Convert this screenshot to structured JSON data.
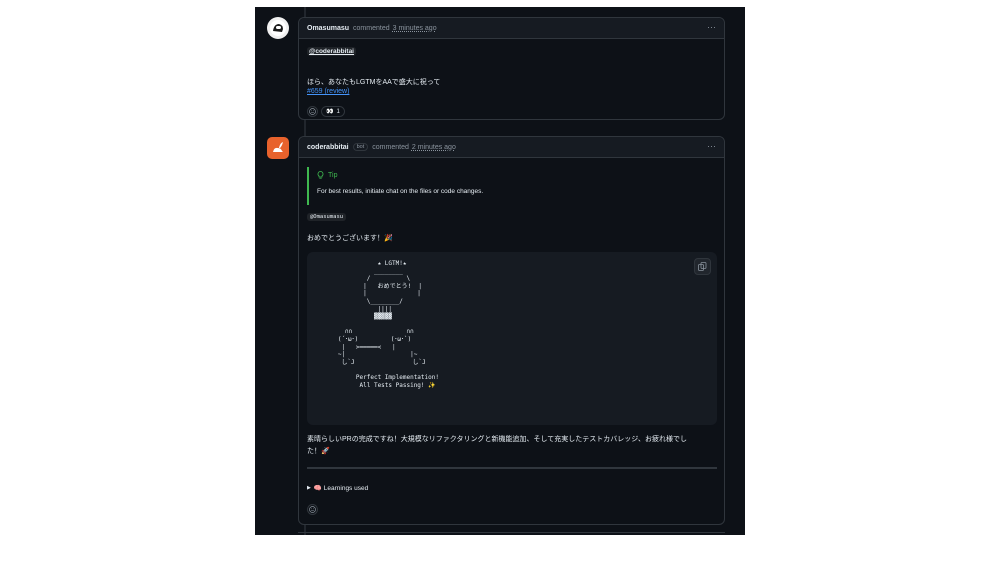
{
  "comment1": {
    "author": "Omasumasu",
    "action": "commented",
    "time": "3 minutes ago",
    "more": "···",
    "mention": "@coderabbitai",
    "text": "ほら、あなたもLGTMをAAで盛大に祝って",
    "link": "#659 (review)",
    "reaction_emoji": "👀",
    "reaction_count": "1"
  },
  "comment2": {
    "author": "coderabbitai",
    "badge": "bot",
    "action": "commented",
    "time": "2 minutes ago",
    "more": "···",
    "tip_title": "Tip",
    "tip_text": "For best results, initiate chat on the files or code changes.",
    "mention": "@Omasumasu",
    "congrats": "おめでとうございます！🎉",
    "ascii_art": "              ★ LGTM!★\n             ________\n           /          \\\n          |   おめでとう!  |\n          |              |\n           \\________/\n              ||||\n             ▓▓▓▓▓\n\n     ∩∩               ∩∩\n   (´･ω･)         (･ω･`)\n    |   >━━━━━<   |\n   ~|                  |~\n    し`J                し`J\n\n        Perfect Implementation!\n         All Tests Passing! ✨",
    "summary_line1": "素晴らしいPRの完成ですね！大規模なリファクタリングと新機能追加、そして充実したテストカバレッジ、お疲れ様でし",
    "summary_line2": "た！🚀",
    "details_label": "🧠 Learnings used"
  },
  "colors": {
    "background": "#0d1117",
    "header": "#161b22",
    "border": "#30363d",
    "text": "#e6edf3",
    "muted": "#8b949e",
    "link": "#4493f8",
    "tip": "#3fb950",
    "bot_avatar": "#e8622c"
  }
}
